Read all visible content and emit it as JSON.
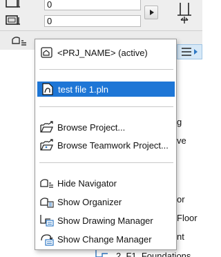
{
  "toolbar": {
    "field_top_value": "0",
    "field_bottom_value": "0"
  },
  "background": {
    "fragments": [
      "g",
      "ve",
      "or",
      "Floor",
      "nt",
      "2. F1. Foundations"
    ]
  },
  "menu": {
    "project_name_label": "<PRJ_NAME> (active)",
    "test_file_label": "test file 1.pln",
    "browse_project_label": "Browse Project...",
    "browse_teamwork_label": "Browse Teamwork Project...",
    "hide_navigator_label": "Hide Navigator",
    "show_organizer_label": "Show Organizer",
    "show_drawing_manager_label": "Show Drawing Manager",
    "show_change_manager_label": "Show Change Manager"
  },
  "colors": {
    "selection": "#1e76d6",
    "accent_blue": "#2f78c4"
  }
}
